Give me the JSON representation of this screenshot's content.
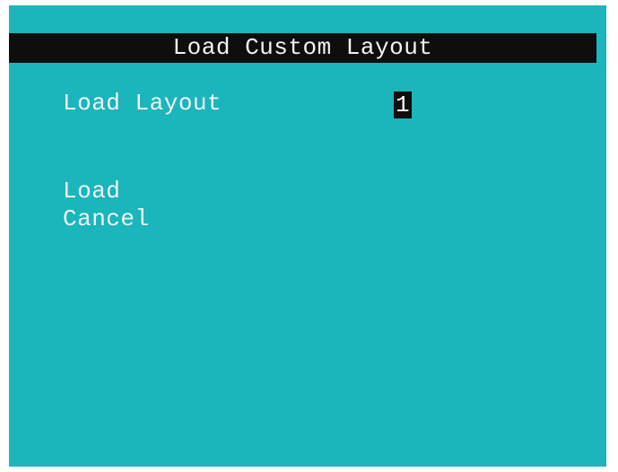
{
  "screen": {
    "title": "Load Custom Layout",
    "field": {
      "label": "Load Layout",
      "value": "1"
    },
    "menu": {
      "load_label": "Load",
      "cancel_label": "Cancel"
    }
  },
  "colors": {
    "background": "#1bb5bc",
    "title_bar": "#0e0e0e",
    "text": "#f2f6f6"
  }
}
